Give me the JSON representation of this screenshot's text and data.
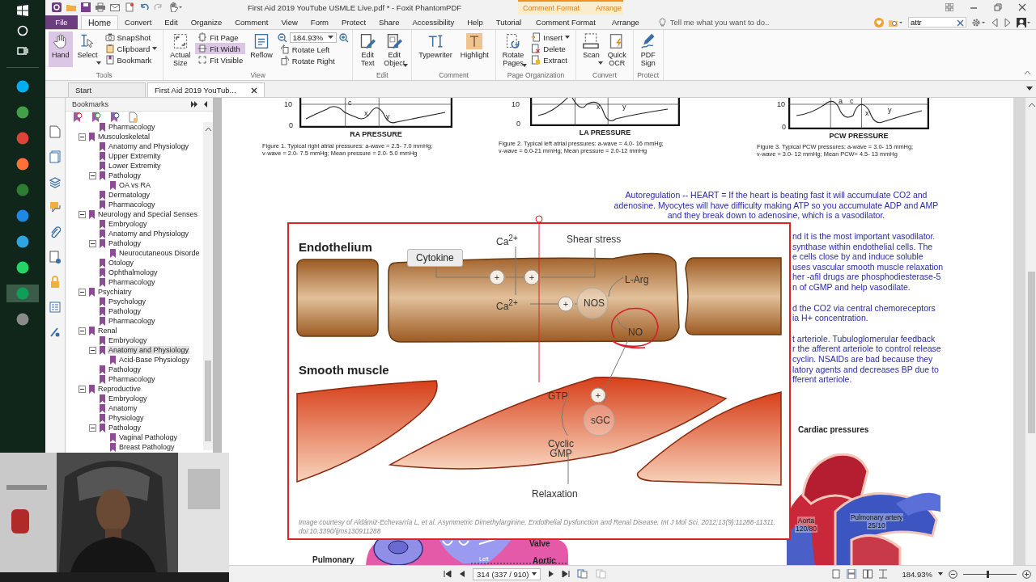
{
  "taskbar": {
    "apps": [
      {
        "color": "#00aff0",
        "selected": false
      },
      {
        "color": "#43a047",
        "selected": false
      },
      {
        "color": "#db4437",
        "selected": false
      },
      {
        "color": "#ff7139",
        "selected": false
      },
      {
        "color": "#2e7d32",
        "selected": false
      },
      {
        "color": "#1e88e5",
        "selected": false
      },
      {
        "color": "#2ca5e0",
        "selected": false
      },
      {
        "color": "#25d366",
        "selected": false
      },
      {
        "color": "#0f9d58",
        "selected": true
      },
      {
        "color": "#8a8a8a",
        "selected": false
      }
    ]
  },
  "window": {
    "title": "First Aid 2019 YouTube USMLE Live.pdf * - Foxit PhantomPDF",
    "context_tabs": [
      "Comment Format",
      "Arrange"
    ]
  },
  "menu_tabs": [
    {
      "label": "File",
      "kind": "file",
      "selected": false
    },
    {
      "label": "Home",
      "kind": "tab",
      "selected": true
    },
    {
      "label": "Convert",
      "kind": "tab",
      "selected": false
    },
    {
      "label": "Edit",
      "kind": "tab",
      "selected": false
    },
    {
      "label": "Organize",
      "kind": "tab",
      "selected": false
    },
    {
      "label": "Comment",
      "kind": "tab",
      "selected": false
    },
    {
      "label": "View",
      "kind": "tab",
      "selected": false
    },
    {
      "label": "Form",
      "kind": "tab",
      "selected": false
    },
    {
      "label": "Protect",
      "kind": "tab",
      "selected": false
    },
    {
      "label": "Share",
      "kind": "tab",
      "selected": false
    },
    {
      "label": "Accessibility",
      "kind": "tab",
      "selected": false
    },
    {
      "label": "Help",
      "kind": "tab",
      "selected": false
    },
    {
      "label": "Tutorial",
      "kind": "tab",
      "selected": false
    },
    {
      "label": "Comment Format",
      "kind": "context",
      "selected": false
    },
    {
      "label": "Arrange",
      "kind": "context",
      "selected": false
    }
  ],
  "tell_me": {
    "placeholder": "Tell me what you want to do.."
  },
  "search": {
    "value": "attr"
  },
  "ribbon": {
    "groups": [
      {
        "name": "Tools",
        "columns": [
          [
            {
              "label": "Hand",
              "kind": "large",
              "selected": true
            }
          ],
          [
            {
              "label": "Select",
              "kind": "large",
              "selected": false,
              "dropdown": true
            }
          ],
          [
            {
              "label": "SnapShot",
              "kind": "small",
              "selected": false
            },
            {
              "label": "Clipboard",
              "kind": "small",
              "selected": false,
              "dropdown": true
            },
            {
              "label": "Bookmark",
              "kind": "small",
              "selected": false
            }
          ]
        ]
      },
      {
        "name": "View",
        "columns": [
          [
            {
              "label": "Actual Size",
              "kind": "large",
              "selected": false
            }
          ],
          [
            {
              "label": "Fit Page",
              "kind": "small",
              "selected": false
            },
            {
              "label": "Fit Width",
              "kind": "small",
              "selected": true
            },
            {
              "label": "Fit Visible",
              "kind": "small",
              "selected": false
            }
          ],
          [
            {
              "label": "Reflow",
              "kind": "large",
              "selected": false
            }
          ],
          [
            {
              "value": "184.93%",
              "kind": "zoom"
            },
            {
              "label": "Rotate Left",
              "kind": "small",
              "selected": false
            },
            {
              "label": "Rotate Right",
              "kind": "small",
              "selected": false
            }
          ]
        ]
      },
      {
        "name": "Edit",
        "columns": [
          [
            {
              "label": "Edit Text",
              "kind": "large",
              "selected": false
            }
          ],
          [
            {
              "label": "Edit Object",
              "kind": "large",
              "selected": false,
              "dropdown": true
            }
          ]
        ]
      },
      {
        "name": "Comment",
        "columns": [
          [
            {
              "label": "Typewriter",
              "kind": "large",
              "selected": false
            }
          ],
          [
            {
              "label": "Highlight",
              "kind": "large",
              "selected": false
            }
          ]
        ]
      },
      {
        "name": "Page Organization",
        "columns": [
          [
            {
              "label": "Rotate Pages",
              "kind": "large",
              "selected": false,
              "dropdown": true
            }
          ],
          [
            {
              "label": "Insert",
              "kind": "small",
              "selected": false,
              "dropdown": true
            },
            {
              "label": "Delete",
              "kind": "small",
              "selected": false
            },
            {
              "label": "Extract",
              "kind": "small",
              "selected": false
            }
          ]
        ]
      },
      {
        "name": "Convert",
        "columns": [
          [
            {
              "label": "Scan",
              "kind": "large",
              "selected": false,
              "dropdown": true
            }
          ],
          [
            {
              "label": "Quick OCR",
              "kind": "large",
              "selected": false
            }
          ]
        ]
      },
      {
        "name": "Protect",
        "columns": [
          [
            {
              "label": "PDF Sign",
              "kind": "large",
              "selected": false
            }
          ]
        ]
      }
    ]
  },
  "doc_tabs": [
    {
      "label": "Start",
      "selected": false,
      "closable": false
    },
    {
      "label": "First Aid 2019 YouTub...",
      "selected": true,
      "closable": true
    }
  ],
  "bookmarks": {
    "title": "Bookmarks",
    "items": [
      {
        "children": [
          {
            "label": "Pharmacology",
            "selected": false
          }
        ]
      },
      {
        "label": "Musculoskeletal",
        "expanded": true,
        "selected": false,
        "children": [
          {
            "label": "Anatomy and Physiology",
            "selected": false
          },
          {
            "label": "Upper Extremity",
            "selected": false
          },
          {
            "label": "Lower Extremity",
            "selected": false
          },
          {
            "label": "Pathology",
            "expanded": true,
            "selected": false,
            "children": [
              {
                "label": "OA vs RA",
                "selected": false
              }
            ]
          },
          {
            "label": "Dermatology",
            "selected": false
          },
          {
            "label": "Pharmacology",
            "selected": false
          }
        ]
      },
      {
        "label": "Neurology and Special Senses",
        "expanded": true,
        "selected": false,
        "children": [
          {
            "label": "Embryology",
            "selected": false
          },
          {
            "label": "Anatomy and Physiology",
            "selected": false
          },
          {
            "label": "Pathology",
            "expanded": true,
            "selected": false,
            "children": [
              {
                "label": "Neurocutaneous Disorde",
                "selected": false
              }
            ]
          },
          {
            "label": "Otology",
            "selected": false
          },
          {
            "label": "Ophthalmology",
            "selected": false
          },
          {
            "label": "Pharmacology",
            "selected": false
          }
        ]
      },
      {
        "label": "Psychiatry",
        "expanded": true,
        "selected": false,
        "children": [
          {
            "label": "Psychology",
            "selected": false
          },
          {
            "label": "Pathology",
            "selected": false
          },
          {
            "label": "Pharmacology",
            "selected": false
          }
        ]
      },
      {
        "label": "Renal",
        "expanded": true,
        "selected": false,
        "children": [
          {
            "label": "Embryology",
            "selected": false
          },
          {
            "label": "Anatomy and Physiology",
            "expanded": true,
            "selected": true,
            "children": [
              {
                "label": "Acid-Base Physiology",
                "selected": false
              }
            ]
          },
          {
            "label": "Pathology",
            "selected": false
          },
          {
            "label": "Pharmacology",
            "selected": false
          }
        ]
      },
      {
        "label": "Reproductive",
        "expanded": true,
        "selected": false,
        "children": [
          {
            "label": "Embryology",
            "selected": false
          },
          {
            "label": "Anatomy",
            "selected": false
          },
          {
            "label": "Physiology",
            "selected": false
          },
          {
            "label": "Pathology",
            "expanded": true,
            "selected": false,
            "children": [
              {
                "label": "Vaginal Pathology",
                "selected": false
              },
              {
                "label": "Breast Pathology",
                "selected": false
              }
            ]
          }
        ]
      }
    ]
  },
  "page": {
    "figures": [
      {
        "title": "RA PRESSURE",
        "ticks": [
          "10",
          "0"
        ],
        "wave_labels": [
          "c",
          "x",
          "y"
        ],
        "caption": [
          "Figure 1. Typical right atrial pressures: a-wave = 2.5- 7.0 mmHg;",
          "v-wave = 2.0- 7.5 mmHg; Mean pressure = 2.0- 5.0 mmHg"
        ]
      },
      {
        "title": "LA PRESSURE",
        "ticks": [
          "10",
          "0"
        ],
        "wave_labels": [
          "x",
          "y"
        ],
        "caption": [
          "Figure 2. Typical left atrial pressures: a-wave = 4.0- 16 mmHg;",
          "v-wave = 6.0-21 mmHg; Mean pressure = 2.0-12 mmHg"
        ]
      },
      {
        "title": "PCW PRESSURE",
        "ticks": [
          "10",
          "0"
        ],
        "wave_labels": [
          "a",
          "c",
          "x",
          "y"
        ],
        "caption": [
          "Figure 3. Typical PCW pressures: a-wave = 3.0- 15 mmHg;",
          "v-wave = 3.0- 12 mmHg; Mean PCW= 4.5- 13 mmHg"
        ]
      }
    ],
    "note": "Autoregulation -- HEART = If the heart is beating fast it will accumulate CO2 and adenosine. Myocytes will have difficulty making ATP so you accumulate ADP and AMP and they break down to adenosine, which is a vasodilator.",
    "side_paragraphs": [
      [
        "nd it is the most important vasodilator.",
        "synthase within endothelial cells. The",
        "e cells close by and induce soluble",
        "uses vascular smooth muscle relaxation",
        "her -afil drugs are phosphodiesterase-5",
        "n of cGMP and help vasodilate."
      ],
      [
        "d the CO2 via central chemoreceptors",
        "ia H+ concentration."
      ],
      [
        "t arteriole. Tubuloglomerular feedback",
        "r the afferent arteriole to control release",
        "cyclin. NSAIDs are bad because they",
        "latory agents and decreases BP due to",
        "fferent arteriole."
      ]
    ],
    "diagram": {
      "section_labels": [
        "Endothelium",
        "Smooth muscle"
      ],
      "cytokine": "Cytokine",
      "shear_stress": "Shear stress",
      "plus_signs": [
        "+",
        "+",
        "+",
        "+"
      ],
      "molecules": [
        "Ca$^{2+}$",
        "Ca$^{2+}$",
        "L-Arg",
        "NO",
        "GTP",
        "Cyclic GMP"
      ],
      "enzymes": [
        "NOS",
        "sGC"
      ],
      "outcome": "Relaxation",
      "credit": "Image courtesy of Aldámiz-Echevarría L, et al. Asymmetric Dimethylarginine, Endothelial Dysfunction and Renal Disease. Int J Mol Sci. 2012;13(9):11288-11311. doi:10.3390/ijms130911288"
    },
    "section_heading": "Cardiac pressures",
    "heart_labels": [
      {
        "name": "Aorta",
        "value": "120/80"
      },
      {
        "name": "Pulmonary artery",
        "value": "25/10"
      }
    ],
    "lower_heart_labels": [
      "Valve",
      "Pulmonary",
      "Left",
      "Aortic"
    ]
  },
  "status_bar": {
    "page_field": "314 (337 / 910)",
    "zoom": "184.93%",
    "zoom_slider": {
      "level": 0.45
    }
  }
}
